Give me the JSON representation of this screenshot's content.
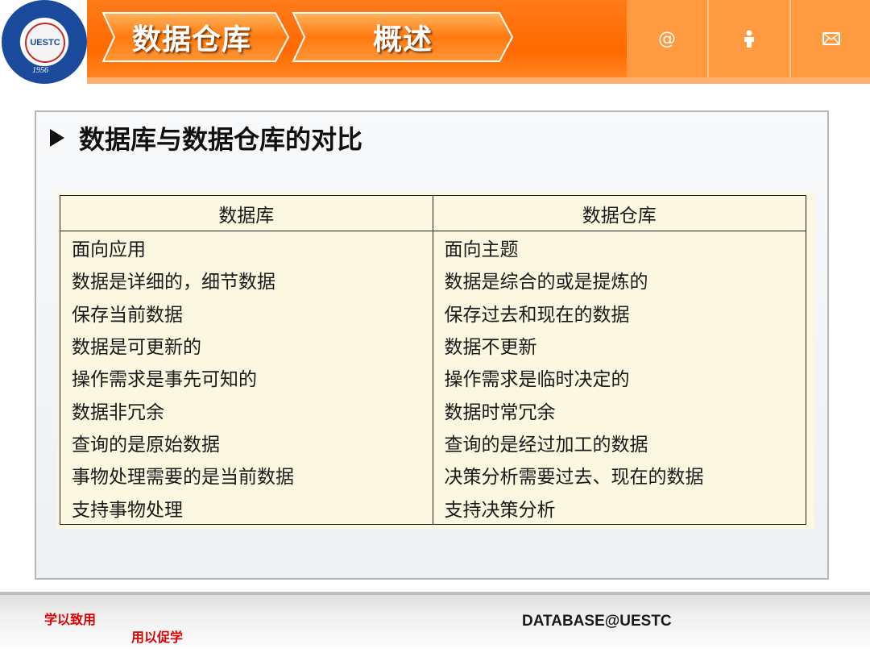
{
  "header": {
    "logo_text": "UESTC",
    "logo_year": "1956",
    "tabs": [
      {
        "label": "数据仓库"
      },
      {
        "label": "概述"
      }
    ],
    "icons": [
      "at-icon",
      "person-icon",
      "mail-icon"
    ]
  },
  "main": {
    "heading": "数据库与数据仓库的对比",
    "table": {
      "headers": [
        "数据库",
        "数据仓库"
      ],
      "rows": [
        [
          "面向应用",
          "面向主题"
        ],
        [
          "数据是详细的，细节数据",
          "数据是综合的或是提炼的"
        ],
        [
          "保存当前数据",
          "保存过去和现在的数据"
        ],
        [
          "数据是可更新的",
          "数据不更新"
        ],
        [
          "操作需求是事先可知的",
          "操作需求是临时决定的"
        ],
        [
          "数据非冗余",
          "数据时常冗余"
        ],
        [
          "查询的是原始数据",
          "查询的是经过加工的数据"
        ],
        [
          "事物处理需要的是当前数据",
          "决策分析需要过去、现在的数据"
        ],
        [
          "支持事物处理",
          "支持决策分析"
        ]
      ]
    }
  },
  "footer": {
    "motto_line1": "学以致用",
    "motto_line2": "用以促学",
    "brand": "DATABASE@UESTC"
  },
  "colors": {
    "accent_orange": "#ff6a00",
    "motto_red": "#e00000",
    "table_bg": "#fbf7e0"
  }
}
